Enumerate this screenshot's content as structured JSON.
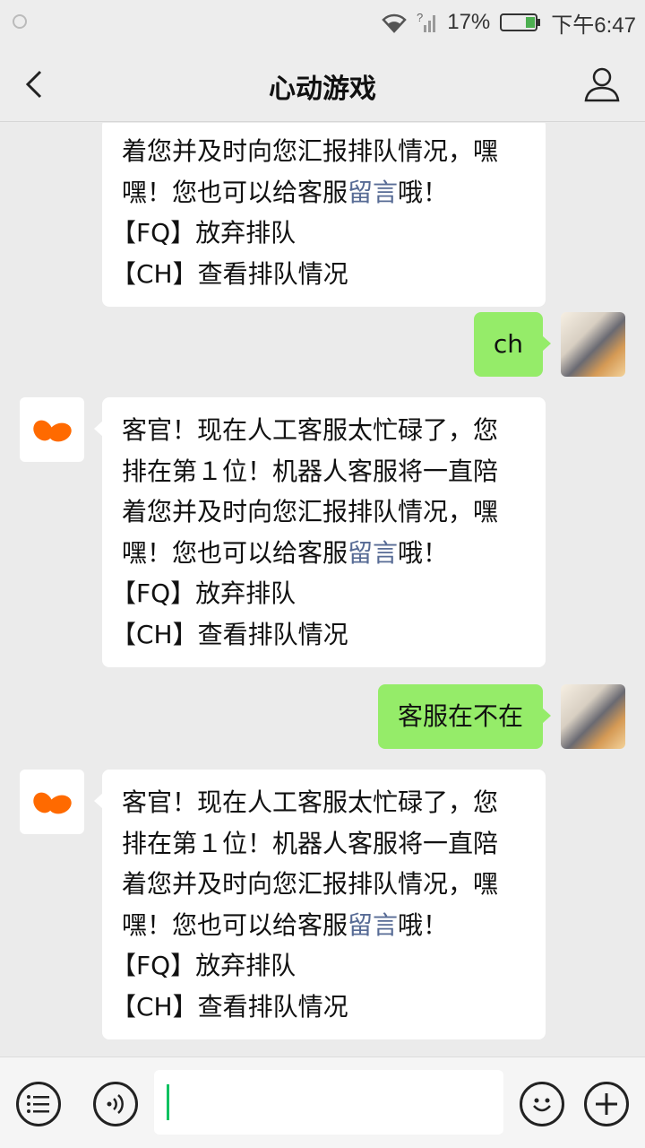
{
  "status_bar": {
    "battery_percent": "17%",
    "time": "下午6:47"
  },
  "header": {
    "title": "心动游戏"
  },
  "messages": [
    {
      "type": "bot",
      "lines": [
        "着您并及时向您汇报排队情况，嘿",
        "嘿！您也可以给客服"
      ],
      "link": "留言",
      "after_link": "哦！",
      "cmd_fq": "【FQ】放弃排队",
      "cmd_ch": "【CH】查看排队情况"
    },
    {
      "type": "user",
      "text": "ch"
    },
    {
      "type": "bot",
      "lines": [
        "客官！现在人工客服太忙碌了，您",
        "排在第１位！机器人客服将一直陪",
        "着您并及时向您汇报排队情况，嘿",
        "嘿！您也可以给客服"
      ],
      "link": "留言",
      "after_link": "哦！",
      "cmd_fq": "【FQ】放弃排队",
      "cmd_ch": "【CH】查看排队情况"
    },
    {
      "type": "user",
      "text": "客服在不在"
    },
    {
      "type": "bot",
      "lines": [
        "客官！现在人工客服太忙碌了，您",
        "排在第１位！机器人客服将一直陪",
        "着您并及时向您汇报排队情况，嘿",
        "嘿！您也可以给客服"
      ],
      "link": "留言",
      "after_link": "哦！",
      "cmd_fq": "【FQ】放弃排队",
      "cmd_ch": "【CH】查看排队情况"
    }
  ],
  "input": {
    "value": ""
  },
  "colors": {
    "user_bubble": "#95ec69",
    "link": "#576b95",
    "bot_brand": "#ff6a00"
  }
}
